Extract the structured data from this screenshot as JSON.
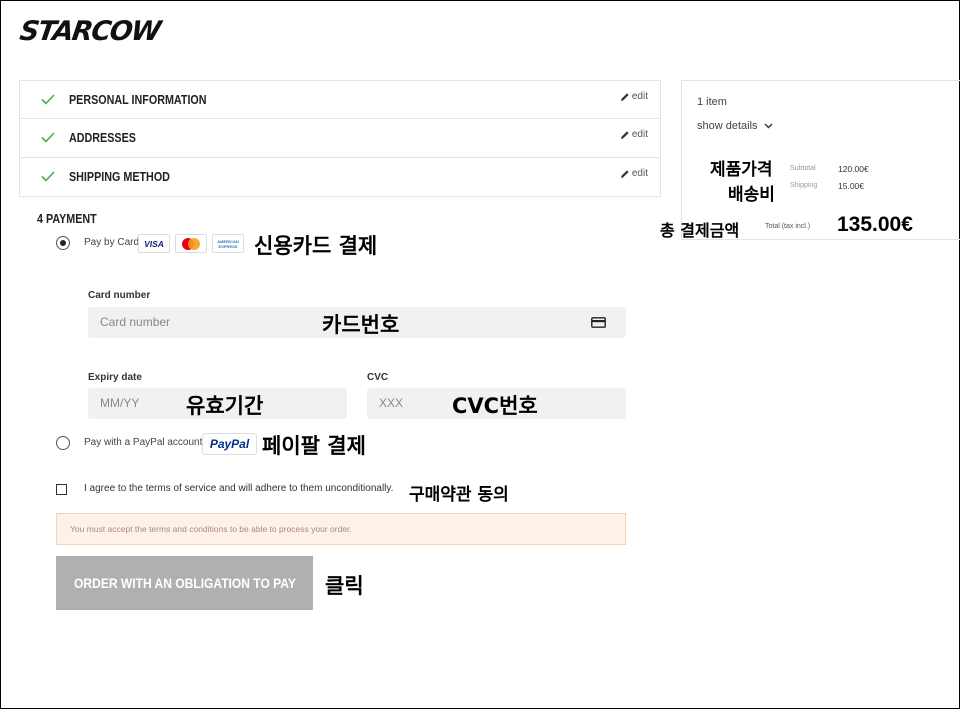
{
  "brand": {
    "logo": "STARCOW"
  },
  "steps": [
    {
      "label": "PERSONAL INFORMATION",
      "edit": "edit"
    },
    {
      "label": "ADDRESSES",
      "edit": "edit"
    },
    {
      "label": "SHIPPING METHOD",
      "edit": "edit"
    }
  ],
  "summary": {
    "items_count": "1 item",
    "show_details": "show details",
    "subtotal_label": "Subtotal",
    "subtotal_value": "120.00€",
    "shipping_label": "Shipping",
    "shipping_value": "15.00€",
    "total_label": "Total (tax incl.)",
    "total_value": "135.00€"
  },
  "payment": {
    "title": "4   PAYMENT",
    "card_option": "Pay by Card",
    "card_brands": [
      "VISA",
      "mastercard",
      "AMERICAN EXPRESS"
    ],
    "card_number_label": "Card number",
    "card_number_placeholder": "Card number",
    "expiry_label": "Expiry date",
    "expiry_placeholder": "MM/YY",
    "cvc_label": "CVC",
    "cvc_placeholder": "XXX",
    "paypal_option": "Pay with a PayPal account",
    "paypal_logo": "PayPal"
  },
  "terms": {
    "label": "I agree to the terms of service and will adhere to them unconditionally.",
    "warning": "You must accept the terms and conditions to be able to process your order."
  },
  "order_button": "ORDER WITH AN OBLIGATION TO PAY",
  "annotations": {
    "product_price": "제품가격",
    "shipping_fee": "배송비",
    "total_payment": "총 결제금액",
    "credit_card": "신용카드 결제",
    "card_number": "카드번호",
    "expiry": "유효기간",
    "cvc": "CVC번호",
    "paypal": "페이팔 결제",
    "terms": "구매약관 동의",
    "click": "클릭"
  },
  "colors": {
    "check": "#4caf50",
    "accent_button": "#b0b0b0",
    "warning_bg": "#fef1e8",
    "paypal_blue": "#003087",
    "paypal_light": "#009cde",
    "visa": "#1a1f71",
    "mc_red": "#eb001b",
    "mc_yellow": "#f79e1b",
    "amex": "#2e77bc"
  }
}
